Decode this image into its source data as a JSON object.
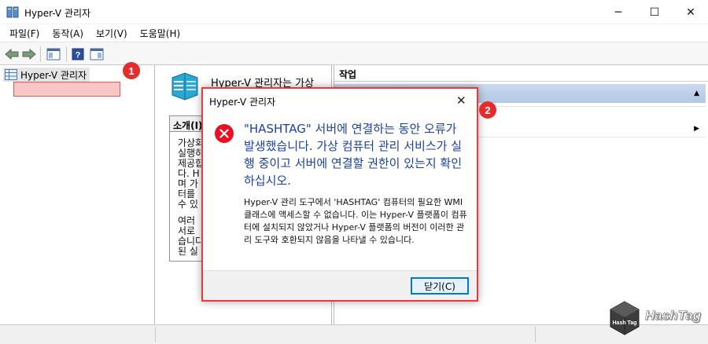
{
  "window": {
    "title": "Hyper-V 관리자",
    "controls": {
      "minimize": "─",
      "maximize": "☐",
      "close": "✕"
    }
  },
  "menubar": {
    "items": [
      "파일(F)",
      "동작(A)",
      "보기(V)",
      "도움말(H)"
    ]
  },
  "toolbar": {
    "buttons": [
      "back-arrow-icon",
      "forward-arrow-icon",
      "console-tree-icon",
      "help-icon",
      "pane-icon"
    ]
  },
  "tree": {
    "root_label": "Hyper-V 관리자"
  },
  "middle": {
    "headline": "Hyper-V 관리자는 가상",
    "intro_header": "소개(I)",
    "intro_lines_1": [
      "가상화",
      "실행하",
      "제공합",
      "다. H",
      "며 가",
      "터를 ",
      "수 있"
    ],
    "intro_lines_2": [
      "여러",
      "서로",
      "습니다",
      "된 실"
    ]
  },
  "actions": {
    "header": "작업"
  },
  "dialog": {
    "title": "Hyper-V 관리자",
    "main_instruction": "\"HASHTAG\" 서버에 연결하는 동안 오류가 발생했습니다. 가상 컴퓨터 관리 서비스가 실행 중이고 서버에 연결할 권한이 있는지 확인하십시오.",
    "content": "Hyper-V 관리 도구에서 'HASHTAG' 컴퓨터의 필요한 WMI 클래스에 액세스할 수 없습니다. 이는 Hyper-V 플랫폼이 컴퓨터에 설치되지 않았거나 Hyper-V 플랫폼의 버전이 이러한 관리 도구와 호환되지 않음을 나타낼 수 있습니다.",
    "close_button": "닫기(C)"
  },
  "annotations": {
    "badge_1": "1",
    "badge_2": "2"
  },
  "watermark": {
    "text": "HashTag",
    "cube_text": "Hash Tag"
  },
  "colors": {
    "annotation_red": "#e32d2d",
    "instruction_blue": "#1a3fa6",
    "button_border": "#0078d7"
  }
}
